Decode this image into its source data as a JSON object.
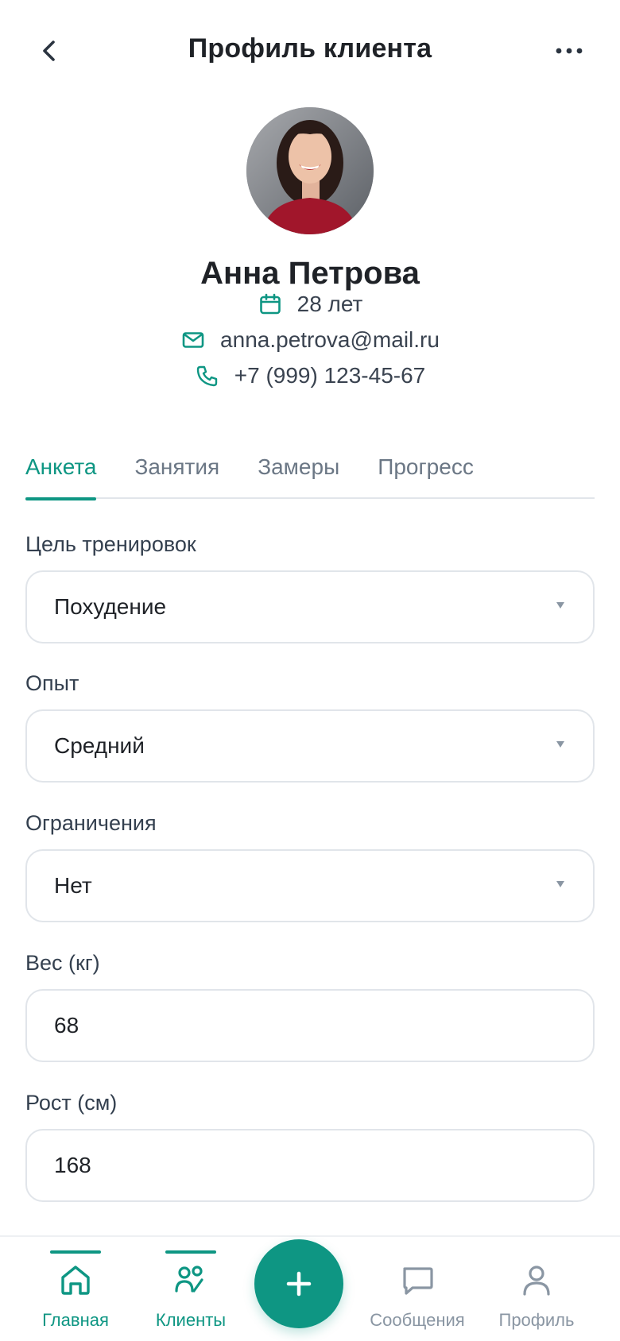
{
  "header": {
    "title": "Профиль клиента",
    "back_icon": "chevron-left-icon",
    "more_icon": "more-horizontal-icon"
  },
  "profile": {
    "name": "Анна Петрова",
    "age": "28 лет",
    "email": "anna.petrova@mail.ru",
    "phone": "+7 (999) 123-45-67"
  },
  "tabs": [
    {
      "label": "Анкета",
      "active": true
    },
    {
      "label": "Занятия",
      "active": false
    },
    {
      "label": "Замеры",
      "active": false
    },
    {
      "label": "Прогресс",
      "active": false
    }
  ],
  "form": {
    "goal": {
      "label": "Цель тренировок",
      "value": "Похудение"
    },
    "experience": {
      "label": "Опыт",
      "value": "Средний"
    },
    "limitations": {
      "label": "Ограничения",
      "value": "Нет"
    },
    "weight": {
      "label": "Вес (кг)",
      "value": "68"
    },
    "height": {
      "label": "Рост (см)",
      "value": "168"
    }
  },
  "bottom_nav": [
    {
      "label": "Главная",
      "icon": "home-icon",
      "active": true
    },
    {
      "label": "Клиенты",
      "icon": "users-icon",
      "active": true
    },
    {
      "label": "Сообщения",
      "icon": "message-icon",
      "active": false
    },
    {
      "label": "Профиль",
      "icon": "user-icon",
      "active": false
    }
  ],
  "colors": {
    "accent": "#0e9683",
    "text": "#1f2227",
    "muted": "#8a96a3",
    "border": "#e1e5ea"
  }
}
